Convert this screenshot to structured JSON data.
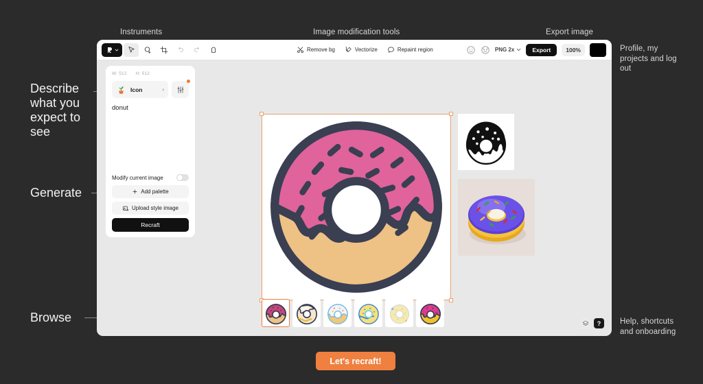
{
  "annotations": {
    "instruments": "Instruments",
    "image_modification_tools": "Image modification tools",
    "export_image": "Export image",
    "profile": "Profile, my projects and log out",
    "help": "Help, shortcuts and onboarding",
    "describe": "Describe what you expect to see",
    "generate": "Generate",
    "browse": "Browse"
  },
  "toolbar": {
    "tools": [
      {
        "name": "logo-button",
        "icon": "recraft-logo"
      },
      {
        "name": "select-tool",
        "icon": "cursor-icon"
      },
      {
        "name": "lasso-add-tool",
        "icon": "lasso-plus-icon"
      },
      {
        "name": "crop-tool",
        "icon": "crop-frame-icon"
      },
      {
        "name": "undo-button",
        "icon": "undo-arrow-icon"
      },
      {
        "name": "redo-button",
        "icon": "redo-arrow-icon"
      },
      {
        "name": "eraser-tool",
        "icon": "eraser-icon"
      }
    ],
    "modification_tools": [
      {
        "label": "Remove bg",
        "icon": "scissors-icon"
      },
      {
        "label": "Vectorize",
        "icon": "vector-pen-icon"
      },
      {
        "label": "Repaint region",
        "icon": "speech-bubble-icon"
      }
    ],
    "avatars": [
      {
        "icon": "smiley-face-icon"
      },
      {
        "icon": "monster-face-icon"
      }
    ],
    "export_format": "PNG 2x",
    "export_label": "Export",
    "zoom_level": "100%",
    "color_swatch": "#000000"
  },
  "panel": {
    "width_label": "W: 512",
    "height_label": "H: 512",
    "style_name": "Icon",
    "style_thumb_icon": "potted-plant-icon",
    "settings_icon": "sliders-icon",
    "prompt_value": "donut",
    "prompt_placeholder": "donut",
    "modify_label": "Modify current image",
    "modify_enabled": false,
    "add_palette_label": "Add palette",
    "upload_style_label": "Upload style image",
    "recraft_label": "Recraft"
  },
  "canvas": {
    "selected_image": "pink-glazed-donut",
    "gallery": [
      {
        "name": "black-white-donut-icon"
      },
      {
        "name": "purple-glazed-3d-donut"
      }
    ],
    "thumbnails": [
      {
        "name": "donut-pink-sprinkles",
        "selected": true
      },
      {
        "name": "donut-white-glaze",
        "selected": false
      },
      {
        "name": "donut-light-pink",
        "selected": false
      },
      {
        "name": "donut-blue-outline",
        "selected": false
      },
      {
        "name": "donut-pale-yellow",
        "selected": false
      },
      {
        "name": "donut-magenta-yellow",
        "selected": false
      }
    ]
  },
  "helpers": {
    "layers_icon": "layers-icon",
    "help_icon": "question-mark-icon"
  },
  "cta": {
    "label": "Let's recraft!",
    "color": "#ef8040"
  },
  "colors": {
    "page_bg": "#2b2b2b",
    "app_bg": "#e8e8e8",
    "accent_orange": "#ef8040",
    "donut_glaze": "#e0639c",
    "donut_dough": "#eec184",
    "donut_outline": "#3a3f52"
  }
}
